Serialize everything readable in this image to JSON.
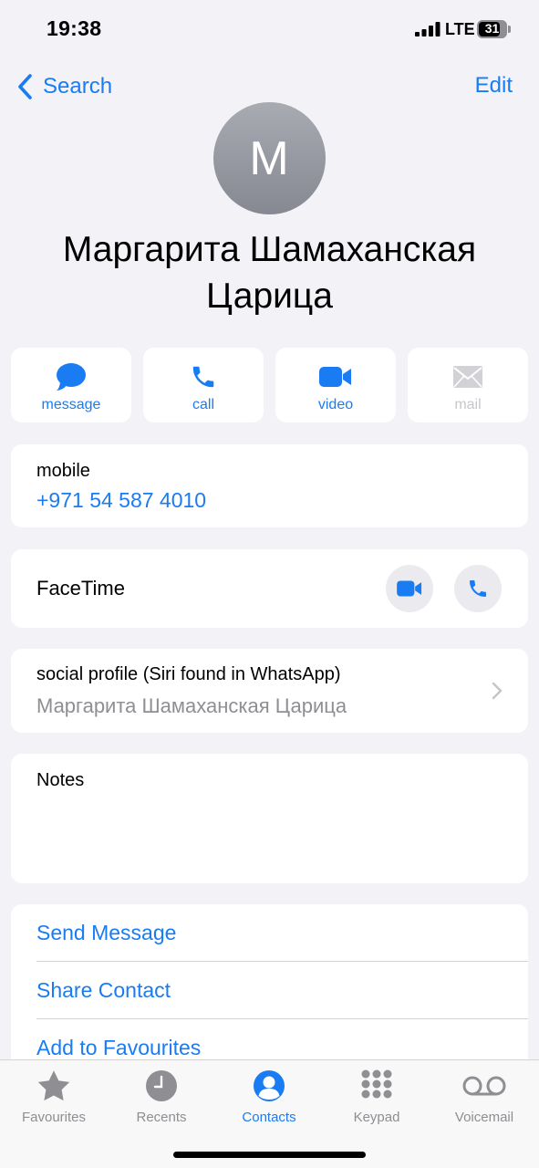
{
  "status_bar": {
    "time": "19:38",
    "network": "LTE",
    "battery": "31"
  },
  "nav": {
    "back_label": "Search",
    "edit_label": "Edit"
  },
  "contact": {
    "initial": "M",
    "name_line1": "Маргарита Шамаханская",
    "name_line2": "Царица"
  },
  "actions": [
    {
      "label": "message",
      "icon": "message-bubble-icon",
      "enabled": true
    },
    {
      "label": "call",
      "icon": "phone-icon",
      "enabled": true
    },
    {
      "label": "video",
      "icon": "video-camera-icon",
      "enabled": true
    },
    {
      "label": "mail",
      "icon": "envelope-icon",
      "enabled": false
    }
  ],
  "phone": {
    "label": "mobile",
    "number": "+971 54 587 4010"
  },
  "facetime": {
    "label": "FaceTime"
  },
  "social_profile": {
    "label": "social profile (Siri found in WhatsApp)",
    "value": "Маргарита Шамаханская Царица"
  },
  "notes": {
    "label": "Notes",
    "value": ""
  },
  "links": [
    "Send Message",
    "Share Contact",
    "Add to Favourites"
  ],
  "tabs": [
    {
      "label": "Favourites",
      "icon": "star-icon",
      "active": false
    },
    {
      "label": "Recents",
      "icon": "clock-icon",
      "active": false
    },
    {
      "label": "Contacts",
      "icon": "person-circle-icon",
      "active": true
    },
    {
      "label": "Keypad",
      "icon": "keypad-grid-icon",
      "active": false
    },
    {
      "label": "Voicemail",
      "icon": "voicemail-icon",
      "active": false
    }
  ],
  "colors": {
    "accent": "#1a7cf2",
    "background": "#f2f2f7",
    "secondary_text": "#8e8e93"
  }
}
